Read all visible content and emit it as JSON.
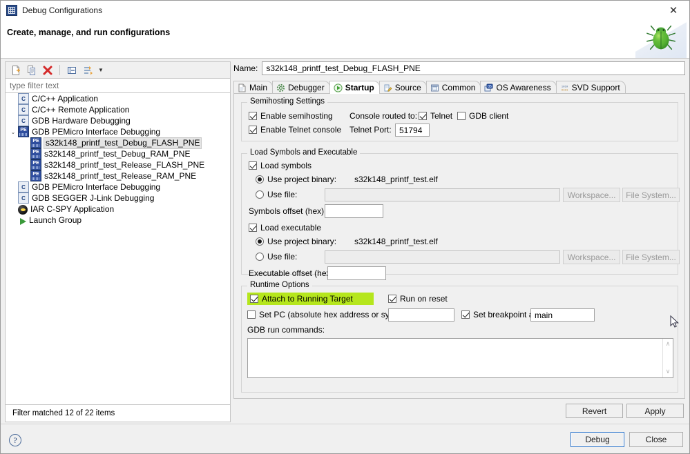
{
  "window": {
    "title": "Debug Configurations",
    "icon": "s32ds-app-icon",
    "close_label": "✕",
    "header_title": "Create, manage, and run configurations",
    "badge_icon": "green-bug-icon"
  },
  "tree_toolbar": {
    "buttons": [
      {
        "name": "new-launch-configuration-button",
        "icon": "new-document-icon"
      },
      {
        "name": "duplicate-configuration-button",
        "icon": "copy-icon"
      },
      {
        "name": "delete-configuration-button",
        "icon": "red-x-icon"
      },
      {
        "name": "collapse-all-button",
        "icon": "collapse-all-icon"
      },
      {
        "name": "filter-configurations-button",
        "icon": "filter-arrows-icon"
      }
    ],
    "dropdown_caret": "▼"
  },
  "filter": {
    "placeholder": "type filter text",
    "value": "",
    "status": "Filter matched 12 of 22 items"
  },
  "tree": {
    "items": [
      {
        "label": "C/C++ Application",
        "icon": "c-app-icon",
        "indent": 0,
        "expander": "",
        "selected": false
      },
      {
        "label": "C/C++ Remote Application",
        "icon": "c-app-icon",
        "indent": 0,
        "expander": "",
        "selected": false
      },
      {
        "label": "GDB Hardware Debugging",
        "icon": "c-app-icon",
        "indent": 0,
        "expander": "",
        "selected": false
      },
      {
        "label": "GDB PEMicro Interface Debugging",
        "icon": "pe-icon",
        "indent": 0,
        "expander": "⌄",
        "selected": false
      },
      {
        "label": "s32k148_printf_test_Debug_FLASH_PNE",
        "icon": "pe-icon",
        "indent": 1,
        "expander": "",
        "selected": true
      },
      {
        "label": "s32k148_printf_test_Debug_RAM_PNE",
        "icon": "pe-icon",
        "indent": 1,
        "expander": "",
        "selected": false
      },
      {
        "label": "s32k148_printf_test_Release_FLASH_PNE",
        "icon": "pe-icon",
        "indent": 1,
        "expander": "",
        "selected": false
      },
      {
        "label": "s32k148_printf_test_Release_RAM_PNE",
        "icon": "pe-icon",
        "indent": 1,
        "expander": "",
        "selected": false
      },
      {
        "label": "GDB PEMicro Interface Debugging",
        "icon": "c-app-icon",
        "indent": 0,
        "expander": "",
        "selected": false
      },
      {
        "label": "GDB SEGGER J-Link Debugging",
        "icon": "c-app-icon",
        "indent": 0,
        "expander": "",
        "selected": false
      },
      {
        "label": "IAR C-SPY Application",
        "icon": "iar-icon",
        "indent": 0,
        "expander": "",
        "selected": false
      },
      {
        "label": "Launch Group",
        "icon": "launch-group-icon",
        "indent": 0,
        "expander": "",
        "selected": false
      }
    ]
  },
  "config": {
    "name_label": "Name:",
    "name_value": "s32k148_printf_test_Debug_FLASH_PNE"
  },
  "tabs": [
    {
      "label": "Main",
      "icon": "document-icon",
      "active": false
    },
    {
      "label": "Debugger",
      "icon": "gear-icon",
      "active": false
    },
    {
      "label": "Startup",
      "icon": "green-play-icon",
      "active": true
    },
    {
      "label": "Source",
      "icon": "source-pencil-icon",
      "active": false
    },
    {
      "label": "Common",
      "icon": "window-icon",
      "active": false
    },
    {
      "label": "OS Awareness",
      "icon": "os-awareness-icon",
      "active": false
    },
    {
      "label": "SVD Support",
      "icon": "svd-icon",
      "active": false
    }
  ],
  "semihosting": {
    "group_title": "Semihosting Settings",
    "enable_semihosting": {
      "label": "Enable semihosting",
      "checked": true
    },
    "console_routed_label": "Console routed to:",
    "telnet": {
      "label": "Telnet",
      "checked": true
    },
    "gdb_client": {
      "label": "GDB client",
      "checked": false
    },
    "enable_telnet_console": {
      "label": "Enable Telnet console",
      "checked": true
    },
    "telnet_port_label": "Telnet Port:",
    "telnet_port_value": "51794"
  },
  "load": {
    "group_title": "Load Symbols and Executable",
    "load_symbols": {
      "label": "Load symbols",
      "checked": true
    },
    "symbols_use_project_binary": {
      "label": "Use project binary:",
      "checked": true,
      "value": "s32k148_printf_test.elf"
    },
    "symbols_use_file": {
      "label": "Use file:",
      "checked": false,
      "value": ""
    },
    "symbols_workspace_button": "Workspace...",
    "symbols_filesystem_button": "File System...",
    "symbols_offset_label": "Symbols offset (hex):",
    "symbols_offset_value": "",
    "load_executable": {
      "label": "Load executable",
      "checked": true
    },
    "exec_use_project_binary": {
      "label": "Use project binary:",
      "checked": true,
      "value": "s32k148_printf_test.elf"
    },
    "exec_use_file": {
      "label": "Use file:",
      "checked": false,
      "value": ""
    },
    "exec_workspace_button": "Workspace...",
    "exec_filesystem_button": "File System...",
    "exec_offset_label": "Executable offset (hex):",
    "exec_offset_value": ""
  },
  "runtime": {
    "group_title": "Runtime Options",
    "attach_to_running_target": {
      "label": "Attach to Running Target",
      "checked": true,
      "highlighted": true
    },
    "run_on_reset": {
      "label": "Run on reset",
      "checked": true
    },
    "set_pc": {
      "label": "Set PC (absolute hex address or symbol):",
      "checked": false,
      "value": ""
    },
    "set_breakpoint_at": {
      "label": "Set breakpoint at:",
      "checked": true,
      "value": "main"
    },
    "gdb_run_commands_label": "GDB run commands:",
    "gdb_run_commands_value": "",
    "scroll_up": "∧",
    "scroll_down": "∨"
  },
  "buttons": {
    "revert": "Revert",
    "apply": "Apply",
    "debug": "Debug",
    "close": "Close",
    "help_glyph": "?"
  },
  "colors": {
    "highlight": "#b5e61d",
    "dialog_bg": "#f0f0f0",
    "accent_blue": "#2a72c8"
  }
}
